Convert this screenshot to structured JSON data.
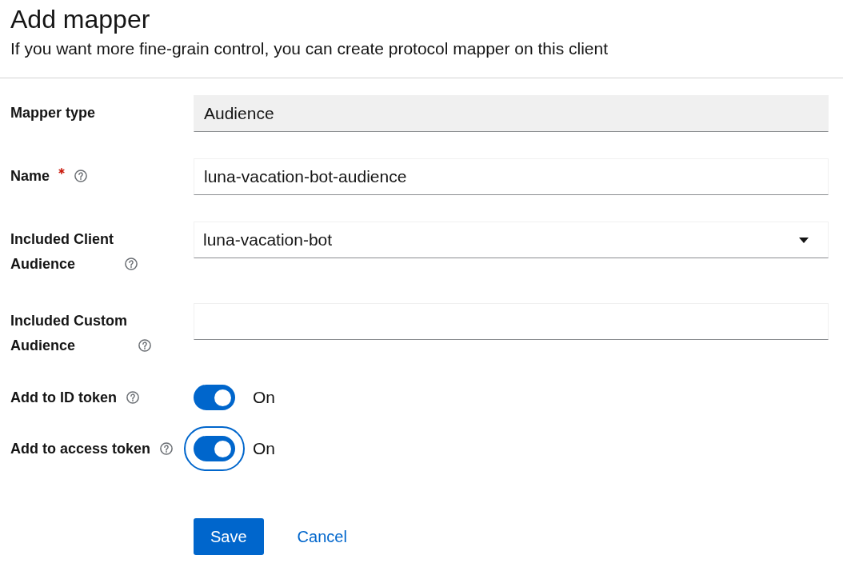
{
  "header": {
    "title": "Add mapper",
    "description": "If you want more fine-grain control, you can create protocol mapper on this client"
  },
  "fields": [
    {
      "kind": "readonly",
      "label": "Mapper type",
      "value": "Audience",
      "required": false,
      "help": false
    },
    {
      "kind": "text",
      "label": "Name",
      "value": "luna-vacation-bot-audience",
      "required": true,
      "help": true
    },
    {
      "kind": "select",
      "label": "Included Client Audience",
      "value": "luna-vacation-bot",
      "required": false,
      "help": true
    },
    {
      "kind": "text",
      "label": "Included Custom Audience",
      "required": false,
      "help": true
    },
    {
      "kind": "switch",
      "label": "Add to ID token",
      "on": true,
      "state_label": "On",
      "focused": false,
      "required": false,
      "help": true
    },
    {
      "kind": "switch",
      "label": "Add to access token",
      "on": true,
      "state_label": "On",
      "focused": true,
      "required": false,
      "help": true
    }
  ],
  "actions": [
    {
      "kind": "primary",
      "label": "Save"
    },
    {
      "kind": "link",
      "label": "Cancel"
    }
  ]
}
